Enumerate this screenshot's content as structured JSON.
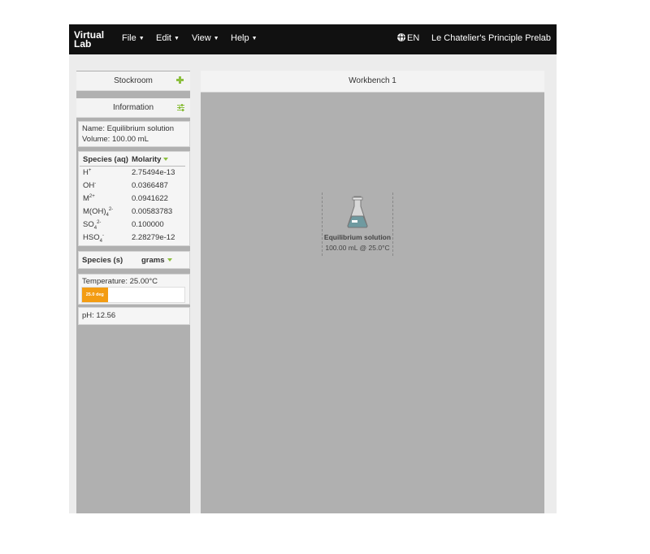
{
  "logo": {
    "line1": "Virtual",
    "line2": "Lab"
  },
  "menu": {
    "file": "File",
    "edit": "Edit",
    "view": "View",
    "help": "Help"
  },
  "language": "EN",
  "app_title": "Le Chatelier's Principle Prelab",
  "stockroom": {
    "label": "Stockroom"
  },
  "information": {
    "label": "Information",
    "name_line": "Name: Equilibrium solution",
    "volume_line": "Volume: 100.00 mL",
    "aq_table": {
      "col_species": "Species (aq)",
      "col_molarity": "Molarity",
      "rows": [
        {
          "base": "H",
          "sub": "",
          "sup": "+",
          "value": "2.75494e-13"
        },
        {
          "base": "OH",
          "sub": "",
          "sup": "-",
          "value": "0.0366487"
        },
        {
          "base": "M",
          "sub": "",
          "sup": "2+",
          "value": "0.0941622"
        },
        {
          "base": "M(OH)",
          "sub": "4",
          "sup": "2-",
          "value": "0.00583783"
        },
        {
          "base": "SO",
          "sub": "4",
          "sup": "2-",
          "value": "0.100000"
        },
        {
          "base": "HSO",
          "sub": "4",
          "sup": "-",
          "value": "2.28279e-12"
        }
      ]
    },
    "solid_table": {
      "col_species": "Species (s)",
      "col_grams": "grams"
    },
    "temperature_line": "Temperature: 25.00°C",
    "temperature_bar": {
      "label": "25.0 deg",
      "fill_fraction": 0.25
    },
    "ph_line": "pH: 12.56"
  },
  "workbench": {
    "title": "Workbench 1",
    "item": {
      "name": "Equilibrium solution",
      "info": "100.00 mL @ 25.0°C"
    }
  },
  "colors": {
    "accent": "#8cbf3f",
    "temp_fill": "#f39c12",
    "topbar": "#111111"
  }
}
